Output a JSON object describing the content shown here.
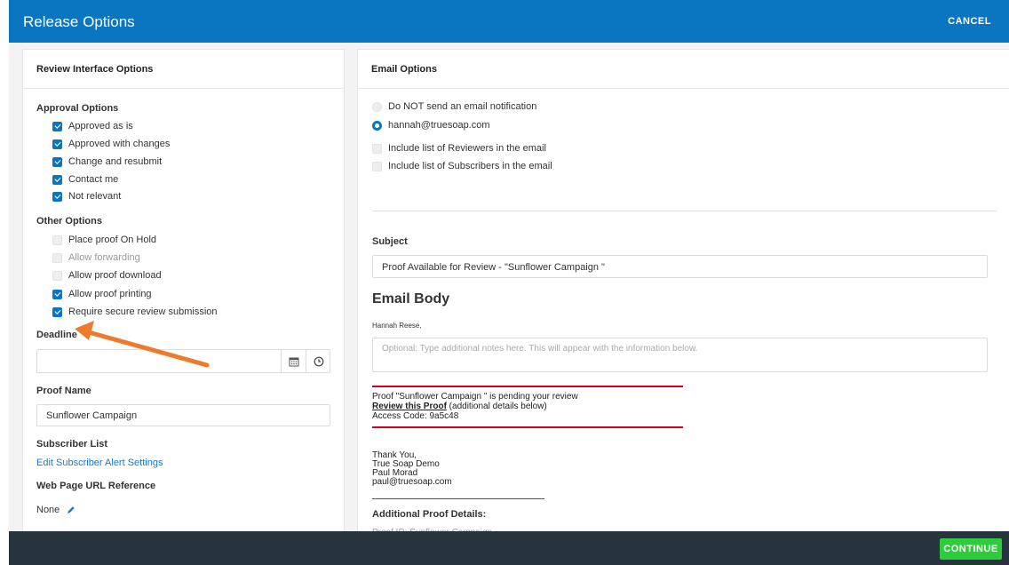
{
  "window": {
    "title": "Release Options",
    "cancel_label": "CANCEL",
    "continue_label": "CONTINUE"
  },
  "left": {
    "heading": "Review Interface Options",
    "approval_title": "Approval Options",
    "approval_options": [
      {
        "label": "Approved as is",
        "checked": true
      },
      {
        "label": "Approved with changes",
        "checked": true
      },
      {
        "label": "Change and resubmit",
        "checked": true
      },
      {
        "label": "Contact me",
        "checked": true
      },
      {
        "label": "Not relevant",
        "checked": true
      }
    ],
    "other_title": "Other Options",
    "other_options": [
      {
        "label": "Place proof On Hold",
        "checked": false
      },
      {
        "label": "Allow forwarding",
        "checked": false,
        "disabled": true
      },
      {
        "label": "Allow proof download",
        "checked": false
      },
      {
        "label": "Allow proof printing",
        "checked": true
      },
      {
        "label": "Require secure review submission",
        "checked": true
      }
    ],
    "deadline_label": "Deadline",
    "deadline_value": "",
    "proof_name_label": "Proof Name",
    "proof_name_value": "Sunflower Campaign",
    "subscriber_label": "Subscriber List",
    "subscriber_link": "Edit Subscriber Alert Settings",
    "url_label": "Web Page URL Reference",
    "url_value": "None"
  },
  "right": {
    "heading": "Email Options",
    "notify_options": [
      {
        "label": "Do NOT send an email notification",
        "selected": false
      },
      {
        "label": "hannah@truesoap.com",
        "selected": true
      }
    ],
    "include_options": [
      {
        "label": "Include list of Reviewers in the email",
        "checked": false
      },
      {
        "label": "Include list of Subscribers in the email",
        "checked": false
      }
    ],
    "subject_label": "Subject",
    "subject_value": "Proof Available for Review - \"Sunflower Campaign \"",
    "body_title": "Email Body",
    "greeting": "Hannah Reese,",
    "notes_placeholder": "Optional: Type additional notes here. This will appear with the information below.",
    "pending_line": "Proof \"Sunflower Campaign \" is pending your review",
    "review_link": "Review this Proof",
    "review_suffix": " (additional details below)",
    "access_code": "Access Code: 9a5c48",
    "signature": [
      "Thank You,",
      "True Soap Demo",
      "Paul Morad",
      "paul@truesoap.com"
    ],
    "additional_title": "Additional Proof Details:",
    "proof_id_line": "Proof ID: Sunflower Campaign"
  },
  "colors": {
    "header": "#0a76c2",
    "footer": "#27333d",
    "continue": "#2dcc3a",
    "arrow": "#ee7b2c",
    "divider_red": "#d0021b",
    "divider_blue": "#1b5fa8"
  }
}
